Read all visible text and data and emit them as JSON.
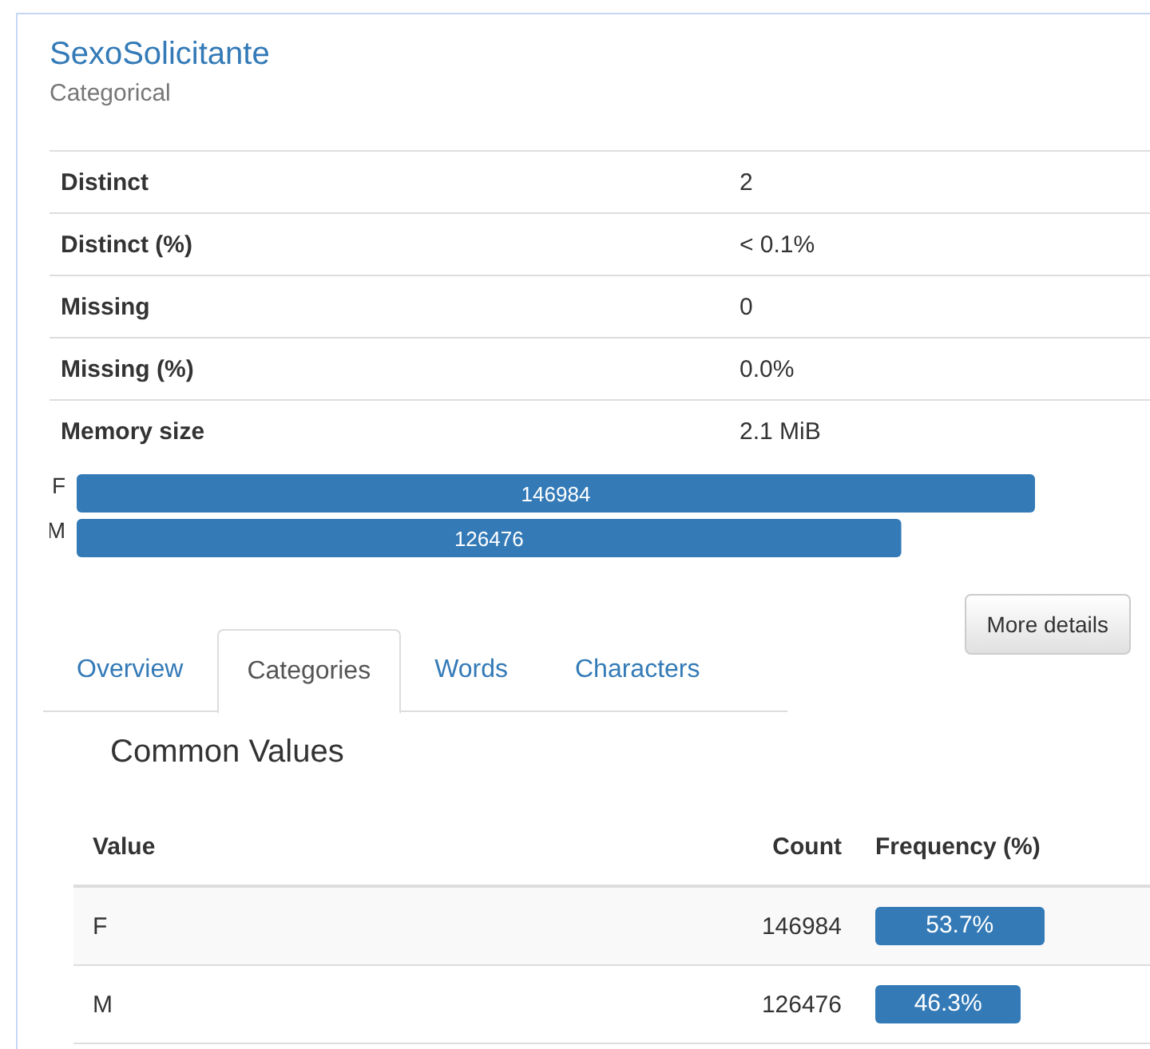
{
  "variable": {
    "name": "SexoSolicitante",
    "type": "Categorical"
  },
  "stats": [
    {
      "label": "Distinct",
      "value": "2"
    },
    {
      "label": "Distinct (%)",
      "value": "< 0.1%"
    },
    {
      "label": "Missing",
      "value": "0"
    },
    {
      "label": "Missing (%)",
      "value": "0.0%"
    },
    {
      "label": "Memory size",
      "value": "2.1 MiB"
    }
  ],
  "chart_data": {
    "type": "bar",
    "orientation": "horizontal",
    "categories": [
      "F",
      "M"
    ],
    "values": [
      146984,
      126476
    ],
    "data_labels": true
  },
  "more_details_button": "More details",
  "tabs": [
    {
      "label": "Overview",
      "selected": false
    },
    {
      "label": "Categories",
      "selected": true
    },
    {
      "label": "Words",
      "selected": false
    },
    {
      "label": "Characters",
      "selected": false
    }
  ],
  "common_values": {
    "title": "Common Values",
    "columns": [
      "Value",
      "Count",
      "Frequency (%)"
    ],
    "rows": [
      {
        "value": "F",
        "count": "146984",
        "frequency": "53.7%",
        "level": 0.537
      },
      {
        "value": "M",
        "count": "126476",
        "frequency": "46.3%",
        "level": 0.463
      }
    ]
  }
}
